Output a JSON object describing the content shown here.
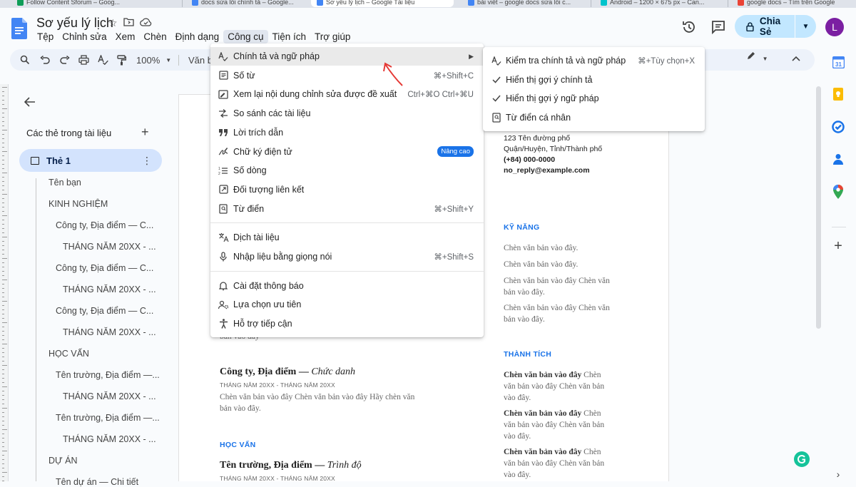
{
  "browser_tabs": [
    {
      "title": "Follow Content Sforum – Goog...",
      "active": false,
      "color": "#0f9d58"
    },
    {
      "title": "docs sửa lỗi chính tả – Google...",
      "active": false,
      "color": "#4285f4"
    },
    {
      "title": "Sơ yếu lý lịch – Google Tài liệu",
      "active": true,
      "color": "#4285f4"
    },
    {
      "title": "bài viết – google docs sửa lỗi c...",
      "active": false,
      "color": "#4285f4"
    },
    {
      "title": "Android – 1200 × 675 px – Can...",
      "active": false,
      "color": "#00c4cc"
    },
    {
      "title": "google docs – Tìm trên Google",
      "active": false,
      "color": "#ea4335"
    }
  ],
  "doc": {
    "title": "Sơ yếu lý lịch",
    "menu": [
      "Tệp",
      "Chỉnh sửa",
      "Xem",
      "Chèn",
      "Định dạng",
      "Công cụ",
      "Tiện ích",
      "Trợ giúp"
    ],
    "open_menu": "Công cụ"
  },
  "header": {
    "share_label": "Chia Sẻ",
    "avatar_letter": "L"
  },
  "toolbar": {
    "zoom": "100%",
    "style": "Văn b"
  },
  "outline": {
    "heading": "Các thẻ trong tài liệu",
    "tab_label": "Thẻ 1",
    "items": [
      {
        "text": "Tên bạn",
        "level": 1
      },
      {
        "text": "KINH NGHIỆM",
        "level": 1
      },
      {
        "text": "Công ty, Địa điểm — C...",
        "level": 2
      },
      {
        "text": "THÁNG NĂM 20XX - ...",
        "level": 3
      },
      {
        "text": "Công ty, Địa điểm — C...",
        "level": 2
      },
      {
        "text": "THÁNG NĂM 20XX - ...",
        "level": 3
      },
      {
        "text": "Công ty, Địa điểm — C...",
        "level": 2
      },
      {
        "text": "THÁNG NĂM 20XX - ...",
        "level": 3
      },
      {
        "text": "HỌC VẤN",
        "level": 1
      },
      {
        "text": "Tên trường, Địa điểm —...",
        "level": 2
      },
      {
        "text": "THÁNG NĂM 20XX - ...",
        "level": 3
      },
      {
        "text": "Tên trường, Địa điểm —...",
        "level": 2
      },
      {
        "text": "THÁNG NĂM 20XX - ...",
        "level": 3
      },
      {
        "text": "DỰ ÁN",
        "level": 1
      },
      {
        "text": "Tên dự án — Chi tiết",
        "level": 2
      }
    ]
  },
  "tools_menu": {
    "groups": [
      [
        {
          "label": "Chính tả và ngữ pháp",
          "icon": "spellcheck-icon",
          "submenu": true,
          "hover": true
        },
        {
          "label": "Số từ",
          "icon": "word-count-icon",
          "shortcut": "⌘+Shift+C"
        },
        {
          "label": "Xem lại nội dung chỉnh sửa được đề xuất",
          "icon": "review-edits-icon",
          "shortcut": "Ctrl+⌘O Ctrl+⌘U"
        },
        {
          "label": "So sánh các tài liệu",
          "icon": "compare-icon"
        },
        {
          "label": "Lời trích dẫn",
          "icon": "quote-icon"
        },
        {
          "label": "Chữ ký điện tử",
          "icon": "signature-icon",
          "badge": "Nâng cao"
        },
        {
          "label": "Số dòng",
          "icon": "line-numbers-icon"
        },
        {
          "label": "Đối tượng liên kết",
          "icon": "linked-objects-icon"
        },
        {
          "label": "Từ điển",
          "icon": "dictionary-icon",
          "shortcut": "⌘+Shift+Y"
        }
      ],
      [
        {
          "label": "Dịch tài liệu",
          "icon": "translate-icon"
        },
        {
          "label": "Nhập liệu bằng giọng nói",
          "icon": "microphone-icon",
          "shortcut": "⌘+Shift+S"
        }
      ],
      [
        {
          "label": "Cài đặt thông báo",
          "icon": "bell-icon"
        },
        {
          "label": "Lựa chọn ưu tiên",
          "icon": "preferences-icon"
        },
        {
          "label": "Hỗ trợ tiếp cận",
          "icon": "accessibility-icon"
        }
      ]
    ]
  },
  "spell_submenu": [
    {
      "label": "Kiểm tra chính tả và ngữ pháp",
      "icon": "spellcheck-icon",
      "shortcut": "⌘+Tùy chọn+X"
    },
    {
      "label": "Hiển thị gợi ý chính tả",
      "icon": "check-icon"
    },
    {
      "label": "Hiển thị gợi ý ngữ pháp",
      "icon": "check-icon"
    },
    {
      "label": "Từ điển cá nhân",
      "icon": "dictionary-icon"
    }
  ],
  "page": {
    "contact": [
      "123 Tên đường phố",
      "Quận/Huyện, Tỉnh/Thành phố",
      "(+84) 000-0000",
      "no_reply@example.com"
    ],
    "skills_heading": "KỸ NĂNG",
    "skills": [
      "Chèn văn bản vào đây.",
      "Chèn văn bản vào đây.",
      "Chèn văn bản vào đây Chèn văn bản vào đây.",
      "Chèn văn bản vào đây Chèn văn bản vào đây."
    ],
    "awards_heading": "THÀNH TÍCH",
    "awards_bold": "Chèn văn bản vào đây",
    "awards_rest": " Chèn văn bản vào đây Chèn văn bản vào đây.",
    "left_partial": "Chèn văn bản vào đây Chèn văn bản vào đây Hãy chèn văn bản vào đây",
    "job_company": "Công ty, Địa điểm — ",
    "job_title": "Chức danh",
    "job_date": "THÁNG NĂM 20XX - THÁNG NĂM 20XX",
    "job_desc": "Chèn văn bản vào đây Chèn văn bản vào đây Hãy chèn văn bản vào đây.",
    "edu_heading": "HỌC VẤN",
    "edu_school": "Tên trường, Địa điểm — ",
    "edu_degree": "Trình độ",
    "edu_date": "THÁNG NĂM 20XX - THÁNG NĂM 20XX"
  }
}
